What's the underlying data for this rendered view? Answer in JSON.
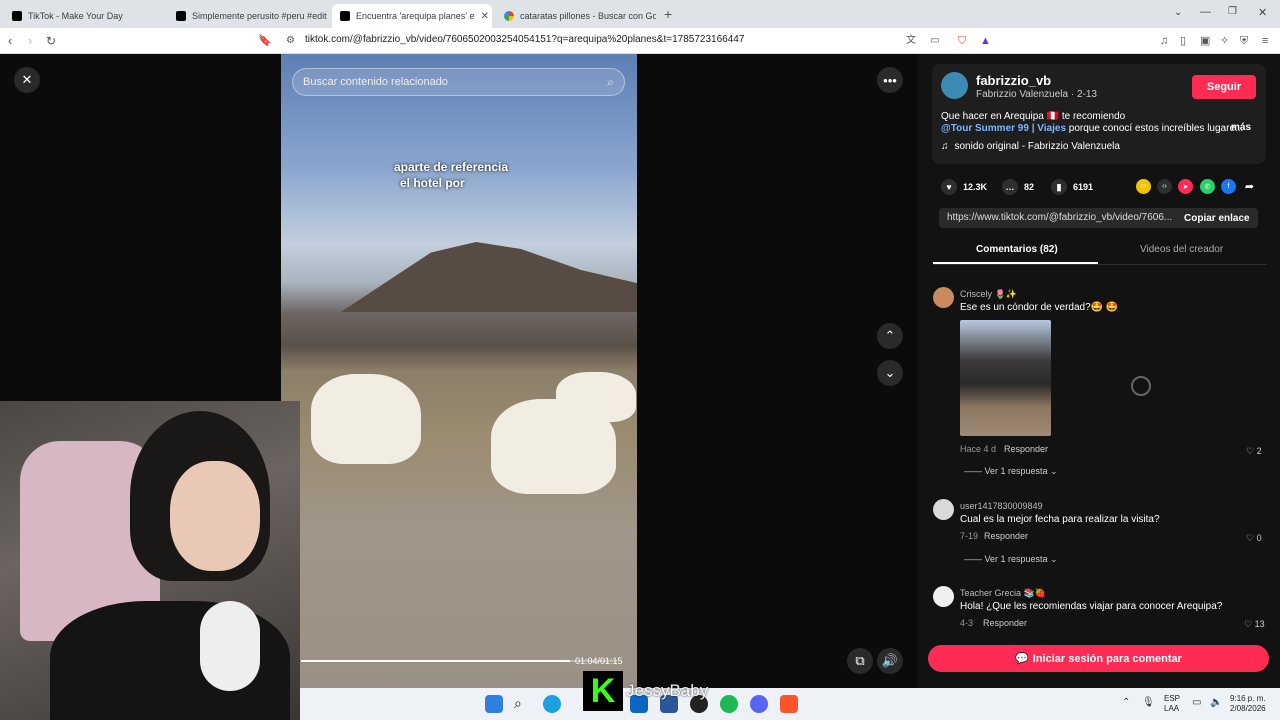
{
  "browser": {
    "tabs": [
      {
        "title": "TikTok - Make Your Day"
      },
      {
        "title": "Simplemente perusito #peru #edit #"
      },
      {
        "title": "Encuentra 'arequipa planes' e"
      },
      {
        "title": "cataratas pillones - Buscar con Googl"
      }
    ],
    "new_tab": "+",
    "url": "tiktok.com/@fabrizzio_vb/video/7606502003254054151?q=arequipa%20planes&t=1785723166447"
  },
  "video": {
    "search_placeholder": "Buscar contenido relacionado",
    "subtitle_line1": "aparte de referencia",
    "subtitle_line2": "el hotel por",
    "time": "01:04/01:15",
    "progress": 0.85
  },
  "post": {
    "username": "fabrizzio_vb",
    "display_name": "Fabrizzio Valenzuela · 2-13",
    "follow_label": "Seguir",
    "description_line1": "Que hacer en Arequipa 🇵🇪 te recomiendo",
    "description_tags": "@Tour Summer 99 | Viajes",
    "description_rest": " porque conocí estos increíbles lugare...",
    "more_label": "más",
    "sound": "sonido original - Fabrizzio Valenzuela",
    "likes": "12.3K",
    "comments": "82",
    "saves": "6191",
    "link": "https://www.tiktok.com/@fabrizzio_vb/video/7606...",
    "copy_label": "Copiar enlace"
  },
  "tabs": {
    "comments": "Comentarios (82)",
    "creator_videos": "Videos del creador"
  },
  "comments": [
    {
      "user": "Criscely 🌷✨",
      "text": "Ese es un cóndor de verdad?🤩 🤩",
      "meta": "Hace 4 d",
      "reply": "Responder",
      "likes": "2",
      "replies": "Ver 1 respuesta"
    },
    {
      "user": "user1417830009849",
      "text": "Cual es la mejor fecha para realizar la visita?",
      "meta": "7-19",
      "reply": "Responder",
      "likes": "0",
      "replies": "Ver 1 respuesta"
    },
    {
      "user": "Teacher Grecia 📚🍓",
      "text": "Hola! ¿Que les recomiendas viajar para conocer Arequipa?",
      "meta": "4-3",
      "reply": "Responder",
      "likes": "13"
    }
  ],
  "login_label": "Iniciar sesión para comentar",
  "overlay": {
    "logo_letter": "K",
    "streamer": "JessyBaby"
  },
  "taskbar": {
    "lang1": "ESP",
    "lang2": "LAA",
    "time": "9:16 p. m.",
    "date": "2/08/2026"
  },
  "colors": {
    "accent": "#fe2c55",
    "link": "#7ab8ff",
    "panel_bg": "#121212"
  }
}
